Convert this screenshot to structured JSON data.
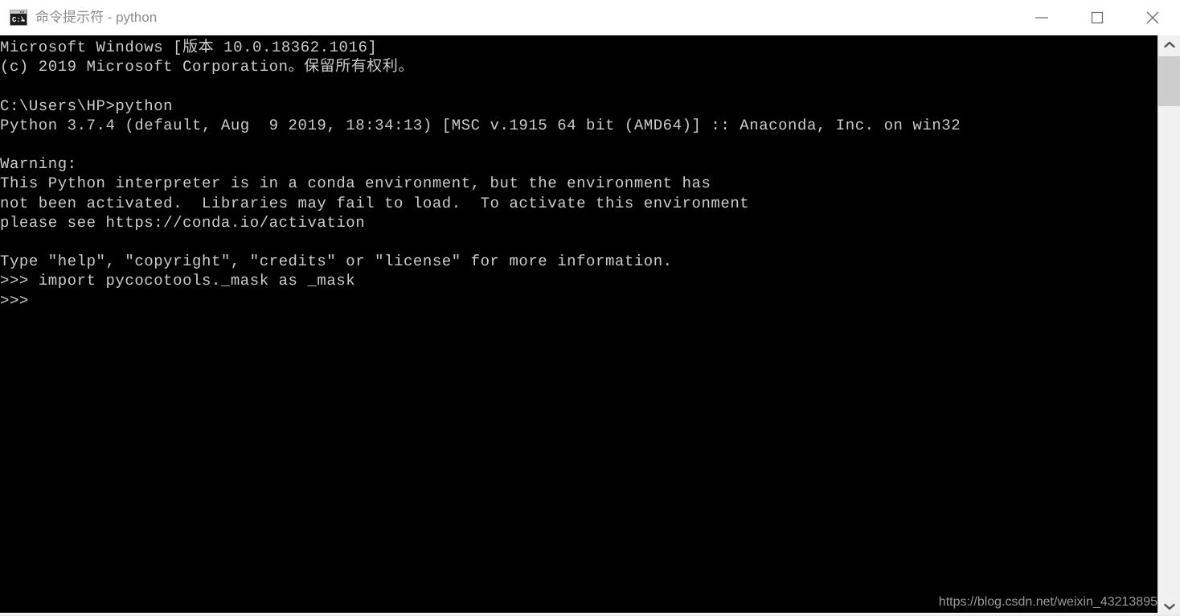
{
  "window": {
    "title": "命令提示符 - python",
    "icon": "cmd-console-icon",
    "controls": {
      "minimize_label": "—",
      "maximize_label": "□",
      "close_label": "✕"
    }
  },
  "console": {
    "background_color": "#000000",
    "text_color": "#cccccc",
    "lines": [
      "Microsoft Windows [版本 10.0.18362.1016]",
      "(c) 2019 Microsoft Corporation。保留所有权利。",
      "",
      "C:\\Users\\HP>python",
      "Python 3.7.4 (default, Aug  9 2019, 18:34:13) [MSC v.1915 64 bit (AMD64)] :: Anaconda, Inc. on win32",
      "",
      "Warning:",
      "This Python interpreter is in a conda environment, but the environment has",
      "not been activated.  Libraries may fail to load.  To activate this environment",
      "please see https://conda.io/activation",
      "",
      "Type \"help\", \"copyright\", \"credits\" or \"license\" for more information.",
      ">>> import pycocotools._mask as _mask",
      ">>>"
    ],
    "full_text": "Microsoft Windows [版本 10.0.18362.1016]\n(c) 2019 Microsoft Corporation。保留所有权利。\n\nC:\\Users\\HP>python\nPython 3.7.4 (default, Aug  9 2019, 18:34:13) [MSC v.1915 64 bit (AMD64)] :: Anaconda, Inc. on win32\n\nWarning:\nThis Python interpreter is in a conda environment, but the environment has\nnot been activated.  Libraries may fail to load.  To activate this environment\nplease see https://conda.io/activation\n\nType \"help\", \"copyright\", \"credits\" or \"license\" for more information.\n>>> import pycocotools._mask as _mask\n>>>"
  },
  "watermark": {
    "text": "https://blog.csdn.net/weixin_43213895"
  },
  "scrollbar": {
    "up_arrow": "chevron-up-icon",
    "down_arrow": "chevron-down-icon",
    "thumb_position": "near-top"
  }
}
